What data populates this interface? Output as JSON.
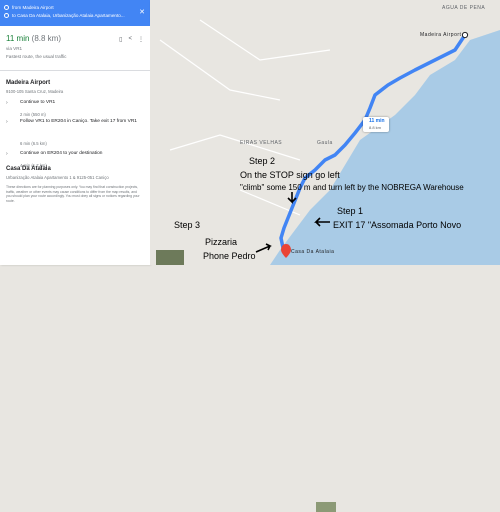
{
  "panel": {
    "from": "from Madeira Airport",
    "to": "to Casa Da Atalaia, Urbanização Atalaia Apartamento...",
    "summary": {
      "time": "11 min",
      "distance": "(8.8 km)",
      "via": "via VR1",
      "note": "Fastest route, the usual traffic"
    },
    "origin": {
      "name": "Madeira Airport",
      "address": "9100-105 Santa Cruz, Madeira"
    },
    "steps": [
      {
        "text": "Continue to VR1",
        "meta": "2 min (550 m)"
      },
      {
        "text": "Follow VR1 to ER204 in Caniço. Take exit 17 from VR1",
        "meta": "6 min (6.5 km)"
      },
      {
        "text": "Continue on ER204 to your destination",
        "meta": "4 min (1.7 km)"
      }
    ],
    "destination": {
      "name": "Casa Da Atalaia",
      "address": "Urbanização Atalaia Apartamento 1 & 9125-051 Caniço"
    },
    "disclaimer": "These directions are for planning purposes only. You may find that construction projects, traffic, weather or other events may cause conditions to differ from the map results, and you should plan your route accordingly. You must obey all signs or notices regarding your route."
  },
  "map": {
    "labels": {
      "agua": "AGUA DE PENA",
      "airport": "Madeira Airport",
      "eiras": "EIRAS VELHAS",
      "gaula": "Gaula",
      "casa": "Casa Da Atalaia"
    },
    "route_box": {
      "time": "11 min",
      "dist": "8.8 km"
    }
  },
  "annotations": {
    "step2_title": "Step 2",
    "step2_line1": "On the STOP sign go left",
    "step2_line2": "\"climb\" some 150 m and turn left by the NOBREGA  Warehouse",
    "step1_title": "Step 1",
    "step1_line": "EXIT 17 \"Assomada Porto Novo",
    "step3_title": "Step 3",
    "pizzaria": "Pizzaria",
    "phone_pedro": "Phone Pedro"
  },
  "colors": {
    "route": "#4285f4",
    "sea": "#a9cbe6",
    "land": "#e8e6e1",
    "accent": "#1a73e8"
  }
}
